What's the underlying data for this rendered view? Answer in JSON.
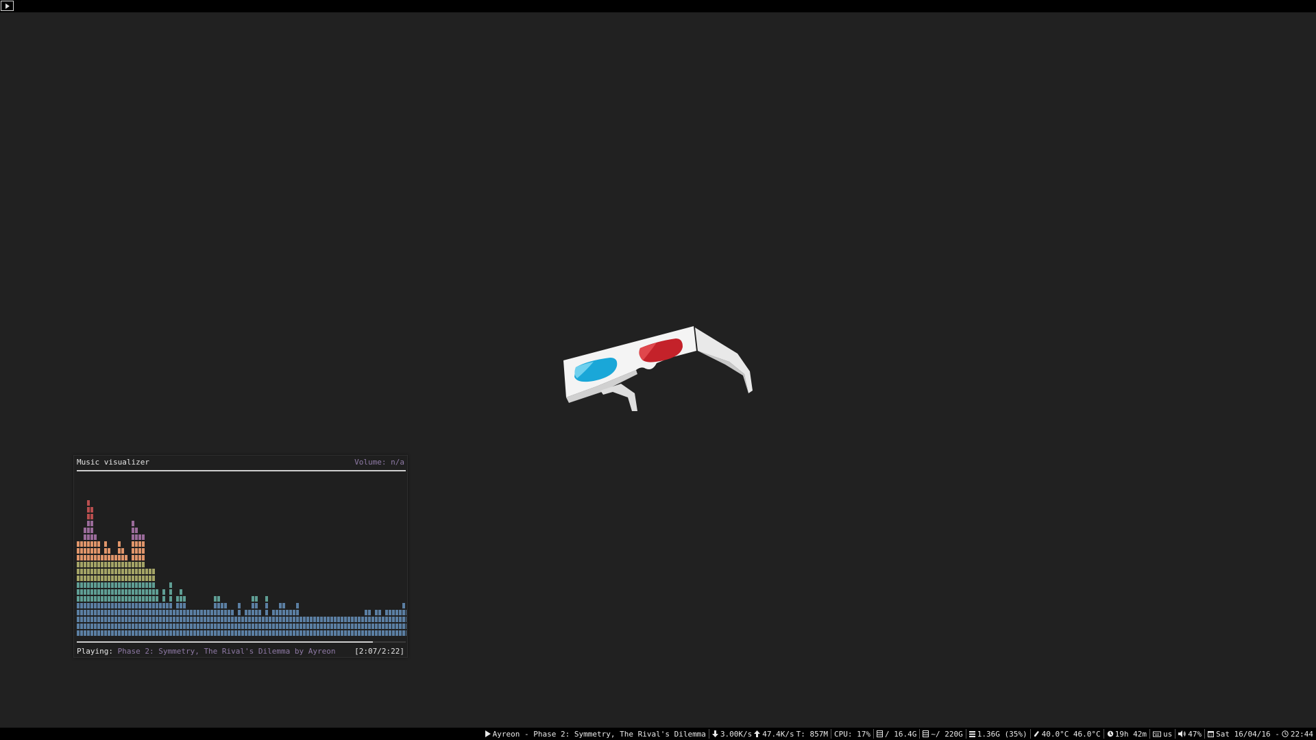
{
  "topbar": {
    "workspace_icon": "play-icon"
  },
  "visualizer": {
    "title": "Music visualizer",
    "volume": "Volume: n/a",
    "playing_label": "Playing:",
    "track": "Phase 2: Symmetry, The Rival's Dilemma by Ayreon",
    "time": "[2:07/2:22]",
    "progress": 0.9,
    "bar_heights": [
      14,
      14,
      16,
      20,
      19,
      15,
      14,
      12,
      14,
      13,
      12,
      12,
      14,
      13,
      12,
      11,
      17,
      16,
      15,
      15,
      10,
      10,
      10,
      7,
      5,
      7,
      5,
      8,
      4,
      6,
      7,
      6,
      4,
      4,
      4,
      4,
      4,
      4,
      4,
      4,
      6,
      6,
      5,
      5,
      4,
      4,
      3,
      5,
      3,
      4,
      4,
      6,
      6,
      4,
      3,
      6,
      3,
      4,
      4,
      5,
      5,
      4,
      4,
      4,
      5,
      3,
      3,
      3,
      3,
      3,
      3,
      3,
      3,
      3,
      3,
      3,
      3,
      3,
      3,
      3,
      3,
      3,
      3,
      3,
      4,
      4,
      3,
      4,
      4,
      3,
      4,
      4,
      4,
      4,
      4,
      5,
      4
    ],
    "colors": {
      "rows_1_5": "#5b7fa3",
      "rows_6_8": "#5f9e94",
      "rows_9_11": "#a4a466",
      "rows_12_14": "#e0956a",
      "rows_15_17": "#9a6b9a",
      "rows_18_20": "#b84e4e"
    }
  },
  "statusbar": {
    "now_playing": "Ayreon - Phase 2: Symmetry, The Rival's Dilemma",
    "net_down": "3.00K/s",
    "net_up": "47.4K/s",
    "net_total": "T: 857M",
    "cpu": "CPU: 17%",
    "disk_root": "/ 16.4G",
    "disk_home": "~/ 220G",
    "mem": "1.36G (35%)",
    "temp": "40.0°C 46.0°C",
    "uptime": "19h 42m",
    "keyboard": "us",
    "volume": "47%",
    "date": "Sat 16/04/16 -",
    "time": "22:44"
  }
}
